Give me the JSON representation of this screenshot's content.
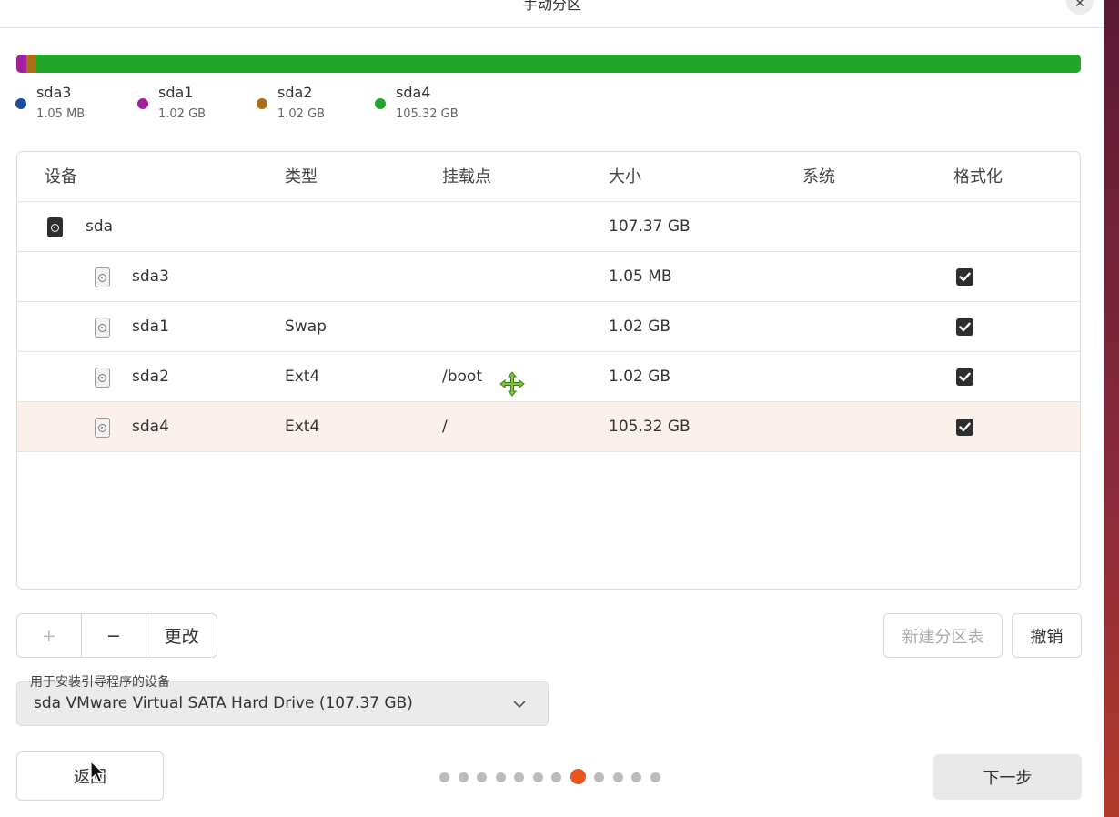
{
  "window": {
    "title": "手动分区",
    "close_icon": "close-icon"
  },
  "usage_bar": {
    "segments": [
      {
        "name": "sda3",
        "fraction": 1e-05,
        "color": "#1a4fa0"
      },
      {
        "name": "sda1",
        "fraction": 0.0095,
        "color": "#a020a0"
      },
      {
        "name": "sda2",
        "fraction": 0.0095,
        "color": "#a87015"
      },
      {
        "name": "sda4",
        "fraction": 0.981,
        "color": "#23a52a"
      }
    ]
  },
  "legend": [
    {
      "name": "sda3",
      "size": "1.05 MB",
      "color": "#1a4fa0"
    },
    {
      "name": "sda1",
      "size": "1.02 GB",
      "color": "#a020a0"
    },
    {
      "name": "sda2",
      "size": "1.02 GB",
      "color": "#a87015"
    },
    {
      "name": "sda4",
      "size": "105.32 GB",
      "color": "#23a52a"
    }
  ],
  "table": {
    "headers": {
      "device": "设备",
      "type": "类型",
      "mount": "挂载点",
      "size": "大小",
      "system": "系统",
      "format": "格式化"
    },
    "rows": [
      {
        "device": "sda",
        "type": "",
        "mount": "",
        "size": "107.37 GB",
        "system": "",
        "format": false
      },
      {
        "device": "sda3",
        "type": "",
        "mount": "",
        "size": "1.05 MB",
        "system": "",
        "format": true
      },
      {
        "device": "sda1",
        "type": "Swap",
        "mount": "",
        "size": "1.02 GB",
        "system": "",
        "format": true
      },
      {
        "device": "sda2",
        "type": "Ext4",
        "mount": "/boot",
        "size": "1.02 GB",
        "system": "",
        "format": true
      },
      {
        "device": "sda4",
        "type": "Ext4",
        "mount": "/",
        "size": "105.32 GB",
        "system": "",
        "format": true
      }
    ]
  },
  "toolbar": {
    "add_label": "+",
    "remove_label": "−",
    "change_label": "更改"
  },
  "actions": {
    "new_table_label": "新建分区表",
    "revert_label": "撤销"
  },
  "bootloader": {
    "label": "用于安装引导程序的设备",
    "value": "sda VMware Virtual SATA Hard Drive (107.37 GB)"
  },
  "footer": {
    "back_label": "返回",
    "next_label": "下一步"
  },
  "pager": {
    "total": 12,
    "current": 8,
    "active_color": "#e95420"
  },
  "colors": {
    "accent": "#e95420",
    "selected_row": "#fcf0ec"
  }
}
